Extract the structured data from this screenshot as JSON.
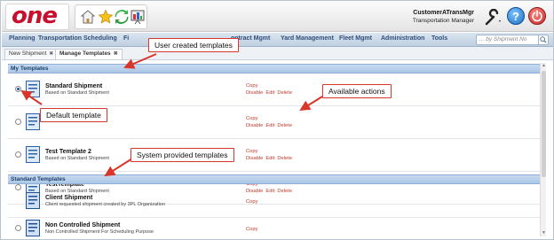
{
  "app": {
    "logo_text": "one"
  },
  "user": {
    "name": "CustomerATransMgr",
    "role": "Transportation Manager"
  },
  "header_icons": [
    "home-icon",
    "star-icon",
    "refresh-icon",
    "presentation-icon",
    "tools-icon",
    "help-icon",
    "power-icon"
  ],
  "nav": {
    "items": [
      "Planning",
      "Transportation",
      "Scheduling",
      "Fi",
      "ontract Mgmt",
      "Yard Management",
      "Fleet Mgmt",
      "Administration",
      "Tools"
    ],
    "search_placeholder": "... by Shipment No"
  },
  "tabs": [
    {
      "label": "New Shipment",
      "close": "✖"
    },
    {
      "label": "Manage Templates",
      "close": "✖"
    }
  ],
  "sections": {
    "my_templates": "My Templates",
    "standard_templates": "Standard Templates"
  },
  "my_templates": [
    {
      "name": "Standard Shipment",
      "desc": "Based on Standard Shipment",
      "actions": [
        "Copy",
        "Disable",
        "Edit",
        "Delete"
      ],
      "selected": true
    },
    {
      "name": "",
      "desc": "",
      "actions": [
        "Copy",
        "Disable",
        "Edit",
        "Delete"
      ],
      "selected": false
    },
    {
      "name": "Test Template 2",
      "desc": "Based on Standard Shipment",
      "actions": [
        "Copy",
        "Disable",
        "Edit",
        "Delete"
      ],
      "selected": false
    },
    {
      "name": "TestTemplate",
      "desc": "Based on Standard Shipment",
      "actions": [
        "Copy",
        "Disable",
        "Edit",
        "Delete"
      ],
      "selected": false
    }
  ],
  "standard_templates": [
    {
      "name": "Client Shipment",
      "desc": "Client requested shipment created by 3PL Organization",
      "actions": [
        "Copy"
      ]
    },
    {
      "name": "Non Controlled Shipment",
      "desc": "Non Controlled Shipment For Scheduling Purpose",
      "actions": [
        "Copy"
      ]
    }
  ],
  "callouts": {
    "user_created": "User created templates",
    "available_actions": "Available actions",
    "default_template": "Default template",
    "system_provided": "System provided templates"
  },
  "colors": {
    "callout_border": "#d9362b",
    "action_text": "#c0392b",
    "section_header": "#aac6e6",
    "brand": "#c8102e"
  }
}
